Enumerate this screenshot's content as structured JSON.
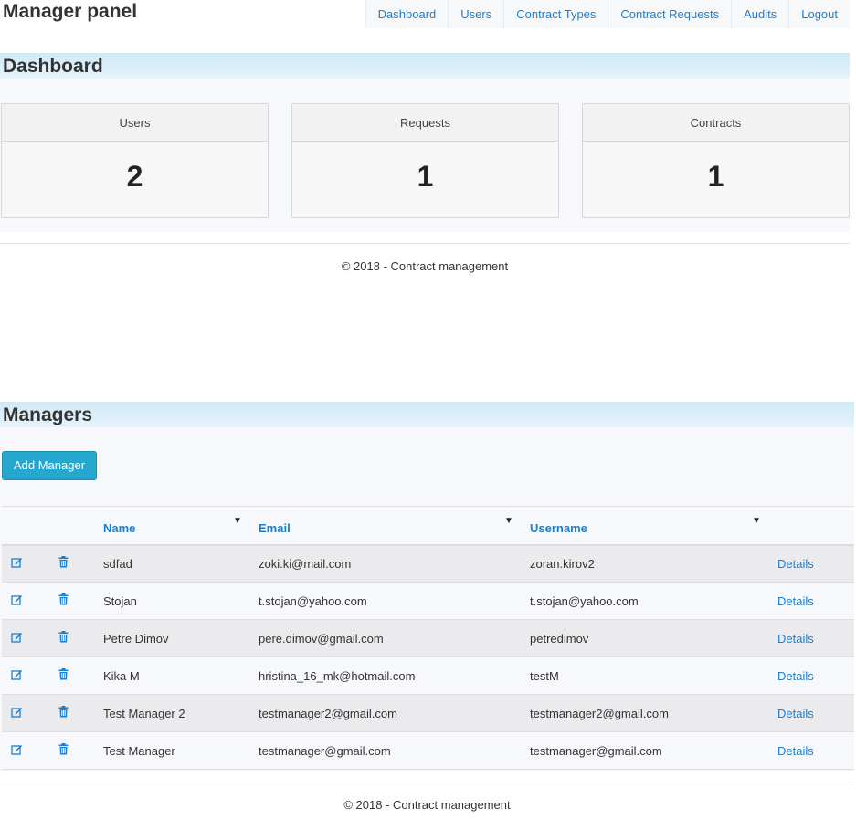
{
  "header": {
    "brand": "Manager panel",
    "nav": [
      "Dashboard",
      "Users",
      "Contract Types",
      "Contract Requests",
      "Audits",
      "Logout"
    ]
  },
  "dashboard": {
    "title": "Dashboard",
    "cards": [
      {
        "label": "Users",
        "value": "2"
      },
      {
        "label": "Requests",
        "value": "1"
      },
      {
        "label": "Contracts",
        "value": "1"
      }
    ],
    "footer": "© 2018 - Contract management"
  },
  "managers": {
    "title": "Managers",
    "add_button": "Add Manager",
    "columns": [
      "Name",
      "Email",
      "Username"
    ],
    "details_label": "Details",
    "rows": [
      {
        "name": "sdfad",
        "email": "zoki.ki@mail.com",
        "username": "zoran.kirov2"
      },
      {
        "name": "Stojan",
        "email": "t.stojan@yahoo.com",
        "username": "t.stojan@yahoo.com"
      },
      {
        "name": "Petre Dimov",
        "email": "pere.dimov@gmail.com",
        "username": "petredimov"
      },
      {
        "name": "Kika M",
        "email": "hristina_16_mk@hotmail.com",
        "username": "testM"
      },
      {
        "name": "Test Manager 2",
        "email": "testmanager2@gmail.com",
        "username": "testmanager2@gmail.com"
      },
      {
        "name": "Test Manager",
        "email": "testmanager@gmail.com",
        "username": "testmanager@gmail.com"
      }
    ],
    "footer": "© 2018 - Contract management"
  },
  "icons": {
    "edit": "edit-icon",
    "delete": "trash-icon",
    "filter": "filter-icon"
  },
  "colors": {
    "link": "#1a7fd1",
    "button": "#26a7cf",
    "section_header": "#d0e9f7"
  }
}
